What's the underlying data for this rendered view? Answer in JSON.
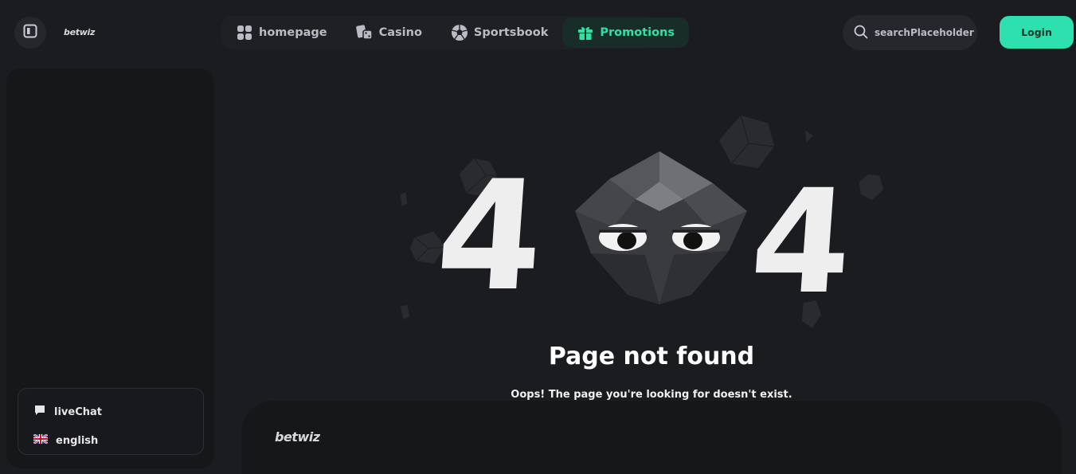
{
  "brand": {
    "name": "betwiz"
  },
  "nav": {
    "items": [
      {
        "label": "homepage",
        "icon": "grid-icon",
        "active": false
      },
      {
        "label": "Casino",
        "icon": "dice-cards-icon",
        "active": false
      },
      {
        "label": "Sportsbook",
        "icon": "soccer-ball-icon",
        "active": false
      },
      {
        "label": "Promotions",
        "icon": "gift-icon",
        "active": true
      }
    ]
  },
  "search": {
    "placeholder": "searchPlaceholder"
  },
  "auth": {
    "login_label": "Login"
  },
  "sidebar": {
    "items": [
      {
        "label": "liveChat",
        "icon": "chat-bubble-icon"
      },
      {
        "label": "english",
        "icon": "uk-flag-icon"
      }
    ]
  },
  "error": {
    "code_left": "4",
    "code_right": "4",
    "title": "Page not found",
    "message": "Oops! The page you're looking for doesn't exist."
  },
  "footer": {
    "logo": "betwiz"
  },
  "colors": {
    "accent": "#2ee0b0",
    "background": "#1b1c1f",
    "panel": "#161719"
  }
}
